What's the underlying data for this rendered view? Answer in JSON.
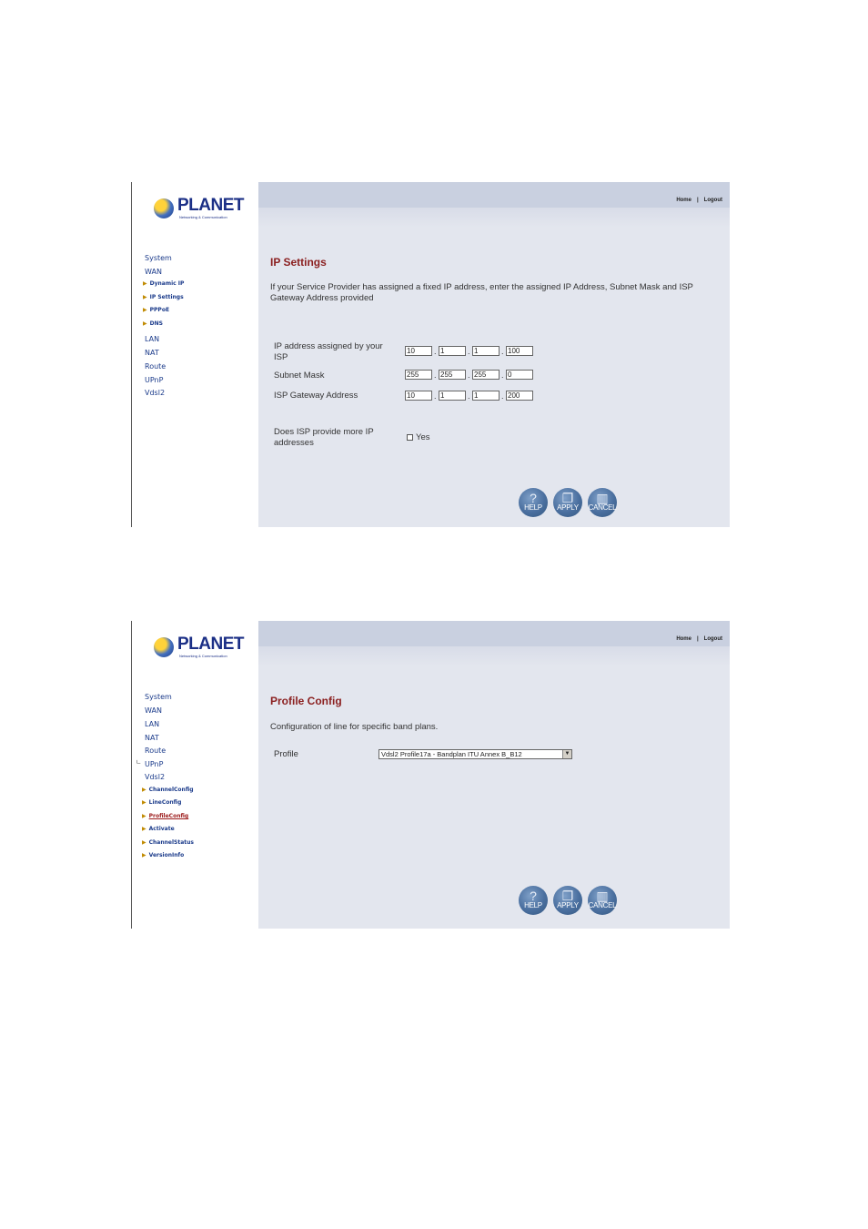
{
  "screens": [
    {
      "logo": {
        "name": "PLANET",
        "tagline": "Networking & Communication"
      },
      "header": {
        "home": "Home",
        "separator": "|",
        "logout": "Logout"
      },
      "nav": {
        "items": [
          "System",
          "WAN"
        ],
        "wan_sub": [
          "Dynamic IP",
          "IP Settings",
          "PPPoE",
          "DNS"
        ],
        "items_after": [
          "LAN",
          "NAT",
          "Route",
          "UPnP",
          "Vdsl2"
        ]
      },
      "page": {
        "title": "IP Settings",
        "description": "If your Service Provider has assigned a fixed IP address, enter the assigned IP Address, Subnet Mask and ISP Gateway Address provided",
        "fields": [
          {
            "label": "IP address assigned by your ISP",
            "octets": [
              "10",
              "1",
              "1",
              "100"
            ]
          },
          {
            "label": "Subnet Mask",
            "octets": [
              "255",
              "255",
              "255",
              "0"
            ]
          },
          {
            "label": "ISP Gateway Address",
            "octets": [
              "10",
              "1",
              "1",
              "200"
            ]
          }
        ],
        "more_ip": {
          "label": "Does ISP provide more IP addresses",
          "option": "Yes",
          "checked": false
        }
      },
      "buttons": {
        "help": "HELP",
        "apply": "APPLY",
        "cancel": "CANCEL"
      }
    },
    {
      "logo": {
        "name": "PLANET",
        "tagline": "Networking & Communication"
      },
      "header": {
        "home": "Home",
        "separator": "|",
        "logout": "Logout"
      },
      "nav": {
        "items": [
          "System",
          "WAN",
          "LAN",
          "NAT",
          "Route",
          "UPnP",
          "Vdsl2"
        ],
        "vdsl2_sub": [
          "ChannelConfig",
          "LineConfig",
          "ProfileConfig",
          "Activate",
          "ChannelStatus",
          "VersionInfo"
        ],
        "active": "ProfileConfig"
      },
      "page": {
        "title": "Profile Config",
        "description": "Configuration of line for specific band plans.",
        "profile_label": "Profile",
        "profile_value": "Vdsl2 Profile17a - Bandplan ITU Annex B_B12"
      },
      "buttons": {
        "help": "HELP",
        "apply": "APPLY",
        "cancel": "CANCEL"
      }
    }
  ]
}
